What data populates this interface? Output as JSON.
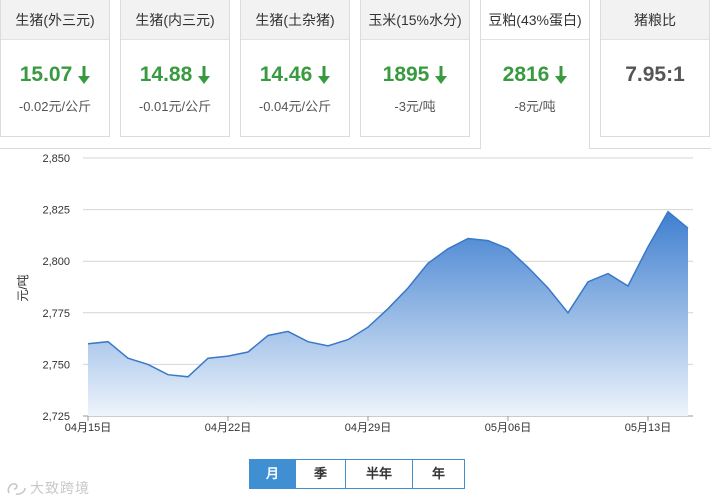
{
  "cards": [
    {
      "title": "生猪(外三元)",
      "value": "15.07",
      "change": "-0.02元/公斤",
      "trend": "down",
      "active": false
    },
    {
      "title": "生猪(内三元)",
      "value": "14.88",
      "change": "-0.01元/公斤",
      "trend": "down",
      "active": false
    },
    {
      "title": "生猪(土杂猪)",
      "value": "14.46",
      "change": "-0.04元/公斤",
      "trend": "down",
      "active": false
    },
    {
      "title": "玉米(15%水分)",
      "value": "1895",
      "change": "-3元/吨",
      "trend": "down",
      "active": false
    },
    {
      "title": "豆粕(43%蛋白)",
      "value": "2816",
      "change": "-8元/吨",
      "trend": "down",
      "active": true
    },
    {
      "title": "猪粮比",
      "value": "7.95:1",
      "change": "",
      "trend": "none",
      "active": false
    }
  ],
  "chart_data": {
    "type": "area",
    "ylabel": "元/吨",
    "ylim": [
      2725,
      2850
    ],
    "yticks": [
      2725,
      2750,
      2775,
      2800,
      2825,
      2850
    ],
    "ytick_labels": [
      "2,725",
      "2,750",
      "2,775",
      "2,800",
      "2,825",
      "2,850"
    ],
    "xtick_labels": [
      "04月15日",
      "04月22日",
      "04月29日",
      "05月06日",
      "05月13日"
    ],
    "xtick_index": [
      0,
      7,
      14,
      21,
      28
    ],
    "x_count": 31,
    "grid": true,
    "area_color_top": "#3f7fd0",
    "area_color_bottom": "#eef4fb",
    "line_color": "#3a78c8",
    "values": [
      2760,
      2761,
      2753,
      2750,
      2745,
      2744,
      2753,
      2754,
      2756,
      2764,
      2766,
      2761,
      2759,
      2762,
      2768,
      2777,
      2787,
      2799,
      2806,
      2811,
      2810,
      2806,
      2797,
      2787,
      2775,
      2790,
      2794,
      2788,
      2807,
      2824,
      2816
    ]
  },
  "periods": [
    {
      "label": "月",
      "active": true
    },
    {
      "label": "季",
      "active": false
    },
    {
      "label": "半年",
      "active": false
    },
    {
      "label": "年",
      "active": false
    }
  ],
  "watermark": {
    "text": "大致跨境"
  }
}
